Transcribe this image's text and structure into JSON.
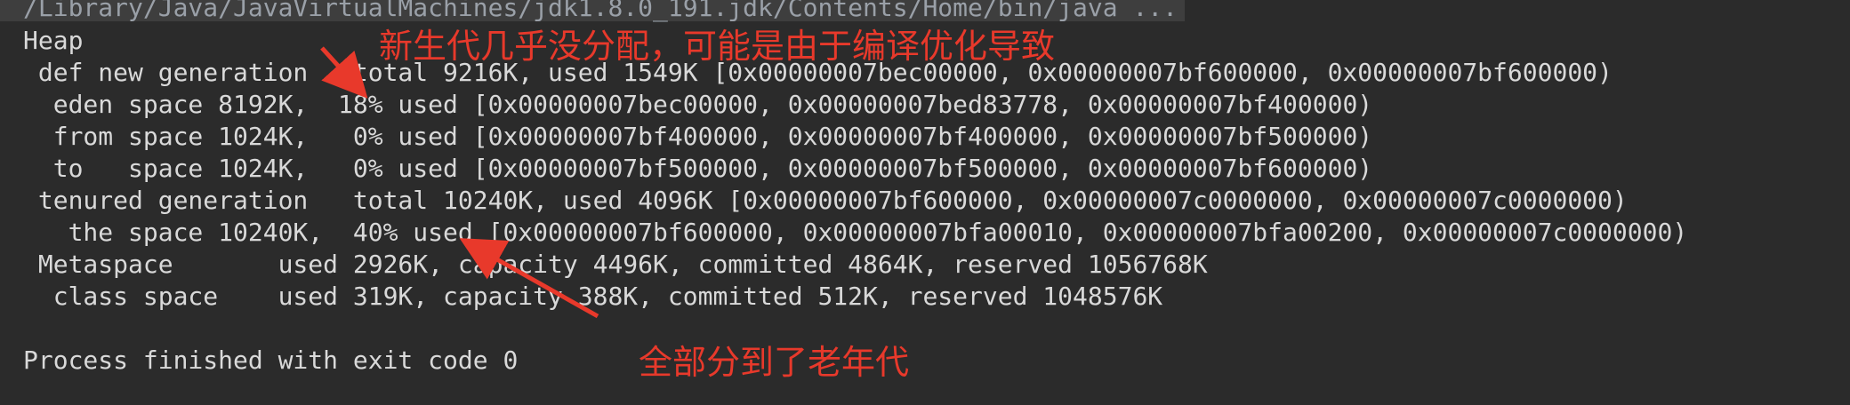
{
  "console": {
    "command": "/Library/Java/JavaVirtualMachines/jdk1.8.0_191.jdk/Contents/Home/bin/java ...",
    "lines": [
      "Heap",
      " def new generation   total 9216K, used 1549K [0x00000007bec00000, 0x00000007bf600000, 0x00000007bf600000)",
      "  eden space 8192K,  18% used [0x00000007bec00000, 0x00000007bed83778, 0x00000007bf400000)",
      "  from space 1024K,   0% used [0x00000007bf400000, 0x00000007bf400000, 0x00000007bf500000)",
      "  to   space 1024K,   0% used [0x00000007bf500000, 0x00000007bf500000, 0x00000007bf600000)",
      " tenured generation   total 10240K, used 4096K [0x00000007bf600000, 0x00000007c0000000, 0x00000007c0000000)",
      "   the space 10240K,  40% used [0x00000007bf600000, 0x00000007bfa00010, 0x00000007bfa00200, 0x00000007c0000000)",
      " Metaspace       used 2926K, capacity 4496K, committed 4864K, reserved 1056768K",
      "  class space    used 319K, capacity 388K, committed 512K, reserved 1048576K",
      "",
      "Process finished with exit code 0"
    ]
  },
  "annotations": {
    "top": "新生代几乎没分配，可能是由于编译优化导致",
    "bottom": "全部分到了老年代",
    "color": "#e8392b"
  }
}
